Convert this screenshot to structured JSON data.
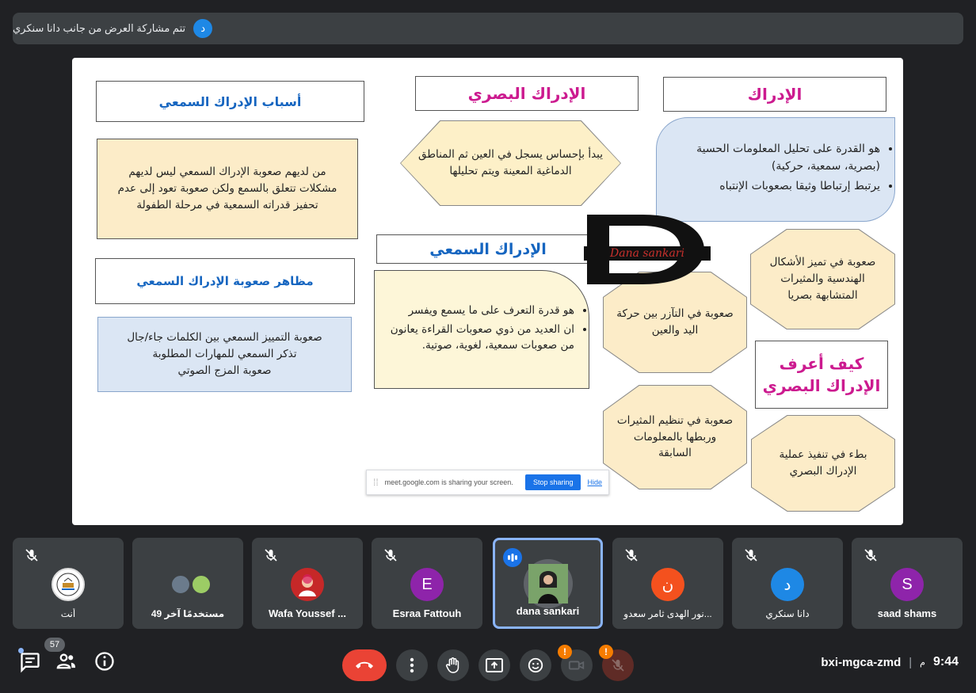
{
  "presenter_bar": {
    "avatar_letter": "د",
    "text": "تتم مشاركة العرض من جانب دانا سنكري"
  },
  "slide": {
    "idrak": {
      "title": "الإدراك",
      "bullets": [
        "هو القدرة على تحليل المعلومات الحسية (بصرية، سمعية، حركية)",
        "يرتبط إرتباطا وثيقا بصعوبات الإنتباه"
      ]
    },
    "visual": {
      "title": "الإدراك البصري",
      "body": "يبدأ بإحساس يسجل في العين ثم المناطق الدماغية المعينة ويتم تحليلها"
    },
    "causes": {
      "title": "أسباب الإدراك السمعي",
      "body": "من لديهم صعوبة الإدراك السمعي ليس لديهم مشكلات تتعلق بالسمع ولكن صعوبة تعود إلى عدم تحفيز قدراته السمعية في مرحلة الطفولة"
    },
    "auditory": {
      "title": "الإدراك السمعي",
      "bullets": [
        "هو قدرة التعرف على ما يسمع ويفسر",
        "ان العديد من ذوي صعوبات القراءة يعانون من صعوبات سمعية، لغوية، صوتية."
      ]
    },
    "aspects": {
      "title": "مظاهر صعوبة الإدراك السمعي",
      "lines": [
        "صعوبة التمييز السمعي بين الكلمات جاء/جال",
        "تذكر السمعي للمهارات المطلوبة",
        "صعوبة المزج الصوتي"
      ]
    },
    "how": {
      "title_line1": "كيف أعرف",
      "title_line2": "الإدراك البصري"
    },
    "oct1": "صعوبة في تميز الأشكال الهندسية والمثيرات المتشابهة بصريا",
    "oct2": "صعوبة في التآزر بين حركة اليد والعين",
    "oct3": "صعوبة في تنظيم المثيرات وربطها بالمعلومات السابقة",
    "oct4": "بطء في تنفيذ عملية الإدراك البصري",
    "logo": {
      "letter": "D",
      "text": "Dana sankari"
    },
    "share_bar": {
      "message": "meet.google.com is sharing your screen.",
      "stop": "Stop sharing",
      "hide": "Hide"
    }
  },
  "participants": [
    {
      "name": "أنت",
      "type": "image"
    },
    {
      "name": "49 مستخدمًا آخر",
      "type": "group"
    },
    {
      "name": "Wafa Youssef ...",
      "type": "image"
    },
    {
      "name": "Esraa Fattouh",
      "letter": "E",
      "color": "#8e24aa"
    },
    {
      "name": "dana sankari",
      "type": "image",
      "active": true
    },
    {
      "name": "نور الهدى ثامر سعدو...",
      "letter": "ن",
      "color": "#f4511e"
    },
    {
      "name": "دانا سنكري",
      "letter": "د",
      "color": "#1e88e5"
    },
    {
      "name": "saad shams",
      "letter": "S",
      "color": "#8e24aa"
    }
  ],
  "bottom": {
    "participant_count": "57",
    "meeting_code": "bxi-mgca-zmd",
    "time": "9:44",
    "ampm": "م",
    "warning": "!"
  }
}
